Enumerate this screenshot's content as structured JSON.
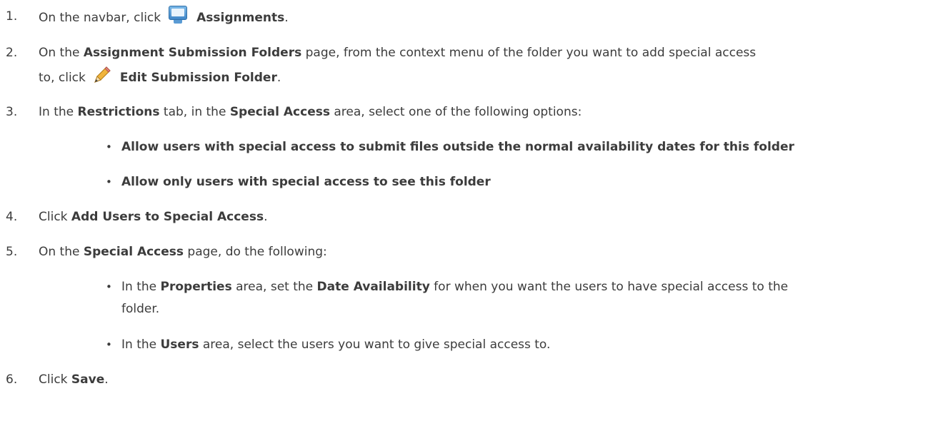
{
  "steps": [
    {
      "num": "1.",
      "parts": [
        "On the navbar, click",
        "Assignments",
        "."
      ],
      "icon": "monitor-icon"
    },
    {
      "num": "2.",
      "parts": [
        "On the ",
        "Assignment Submission Folders",
        " page, from the context menu of the folder you want to add special access",
        "to, click",
        "Edit Submission Folder",
        "."
      ],
      "icon": "pencil-icon"
    },
    {
      "num": "3.",
      "parts": [
        "In the ",
        "Restrictions",
        " tab, in the ",
        "Special Access",
        " area, select one of the following options:"
      ]
    },
    {
      "num": "4.",
      "parts": [
        "Click ",
        "Add Users to Special Access",
        "."
      ]
    },
    {
      "num": "5.",
      "parts": [
        "On the ",
        "Special Access",
        " page, do the following:"
      ]
    },
    {
      "num": "6.",
      "parts": [
        "Click ",
        "Save",
        "."
      ]
    }
  ],
  "step3_options": [
    "Allow users with special access to submit files outside the normal availability dates for this folder",
    "Allow only users with special access to see this folder"
  ],
  "step5_bullets": [
    {
      "parts": [
        "In the ",
        "Properties",
        " area, set the ",
        "Date Availability",
        " for when you want the users to have special access to the",
        "folder."
      ]
    },
    {
      "parts": [
        "In the ",
        "Users",
        " area, select the users you want to give special access to."
      ]
    }
  ],
  "bullet_glyph": "•"
}
